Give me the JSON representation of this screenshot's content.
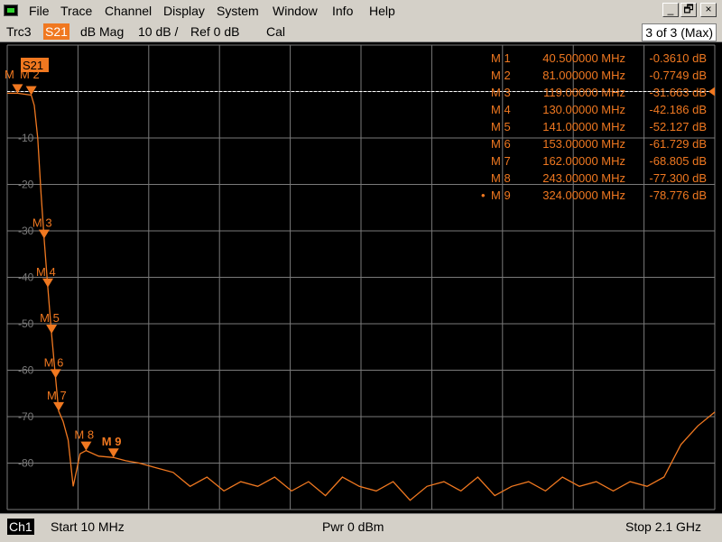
{
  "menubar": {
    "items": [
      "File",
      "Trace",
      "Channel",
      "Display",
      "System",
      "Window",
      "Info",
      "Help"
    ],
    "window_controls": {
      "minimize": "_",
      "restore": "🗗",
      "close": "×"
    }
  },
  "tracebar": {
    "trace_name": "Trc3",
    "measurement": "S21",
    "format": "dB Mag",
    "scale": "10 dB /",
    "reference": "Ref 0 dB",
    "cal": "Cal",
    "stimulus_info": "3 of 3 (Max)"
  },
  "plot": {
    "trace_label": "S21",
    "y_tick_labels": [
      "-10",
      "-20",
      "-30",
      "-40",
      "-50",
      "-60",
      "-70",
      "-80"
    ],
    "colors": {
      "trace": "#f07820",
      "grid": "#7a7a7a",
      "background": "#000000"
    },
    "markers": [
      {
        "label": "M 1",
        "freq": "40.500000 MHz",
        "value": "-0.3610 dB"
      },
      {
        "label": "M 2",
        "freq": "81.000000 MHz",
        "value": "-0.7749 dB"
      },
      {
        "label": "M 3",
        "freq": "119.00000 MHz",
        "value": "-31.663 dB"
      },
      {
        "label": "M 4",
        "freq": "130.00000 MHz",
        "value": "-42.186 dB"
      },
      {
        "label": "M 5",
        "freq": "141.00000 MHz",
        "value": "-52.127 dB"
      },
      {
        "label": "M 6",
        "freq": "153.00000 MHz",
        "value": "-61.729 dB"
      },
      {
        "label": "M 7",
        "freq": "162.00000 MHz",
        "value": "-68.805 dB"
      },
      {
        "label": "M 8",
        "freq": "243.00000 MHz",
        "value": "-77.300 dB"
      },
      {
        "label": "M 9",
        "freq": "324.00000 MHz",
        "value": "-78.776 dB",
        "active": true
      }
    ],
    "stacked_marker_labels": [
      "M",
      "M 2"
    ]
  },
  "bottombar": {
    "channel": "Ch1",
    "start": "Start  10 MHz",
    "power": "Pwr  0 dBm",
    "stop": "Stop  2.1 GHz"
  },
  "chart_data": {
    "type": "line",
    "x_unit": "MHz",
    "y_unit": "dB",
    "xlim": [
      10,
      2100
    ],
    "ylim": [
      -90,
      10
    ],
    "series": [
      {
        "name": "S21",
        "x": [
          10,
          40.5,
          81,
          90,
          100,
          110,
          119,
          130,
          141,
          153,
          162,
          175,
          190,
          205,
          225,
          243,
          280,
          324,
          360,
          400,
          450,
          500,
          550,
          600,
          650,
          700,
          750,
          800,
          850,
          900,
          950,
          1000,
          1050,
          1100,
          1150,
          1200,
          1250,
          1300,
          1350,
          1400,
          1450,
          1500,
          1550,
          1600,
          1650,
          1700,
          1750,
          1800,
          1850,
          1900,
          1950,
          2000,
          2050,
          2100
        ],
        "y": [
          -0.36,
          -0.36,
          -0.77,
          -3,
          -10,
          -22,
          -31.7,
          -42.2,
          -52.1,
          -61.7,
          -68.8,
          -71,
          -75,
          -85,
          -78,
          -77.3,
          -78.5,
          -78.8,
          -79.5,
          -80,
          -81,
          -82,
          -85,
          -83,
          -86,
          -84,
          -85,
          -83,
          -86,
          -84,
          -87,
          -83,
          -85,
          -86,
          -84,
          -88,
          -85,
          -84,
          -86,
          -83,
          -87,
          -85,
          -84,
          -86,
          -83,
          -85,
          -84,
          -86,
          -84,
          -85,
          -83,
          -76,
          -72,
          -69
        ]
      }
    ],
    "markers_data": [
      {
        "name": "M 1",
        "x": 40.5,
        "y": -0.361
      },
      {
        "name": "M 2",
        "x": 81,
        "y": -0.7749
      },
      {
        "name": "M 3",
        "x": 119,
        "y": -31.663
      },
      {
        "name": "M 4",
        "x": 130,
        "y": -42.186
      },
      {
        "name": "M 5",
        "x": 141,
        "y": -52.127
      },
      {
        "name": "M 6",
        "x": 153,
        "y": -61.729
      },
      {
        "name": "M 7",
        "x": 162,
        "y": -68.805
      },
      {
        "name": "M 8",
        "x": 243,
        "y": -77.3
      },
      {
        "name": "M 9",
        "x": 324,
        "y": -78.776
      }
    ],
    "grid": true,
    "reference_line_db": 0
  }
}
